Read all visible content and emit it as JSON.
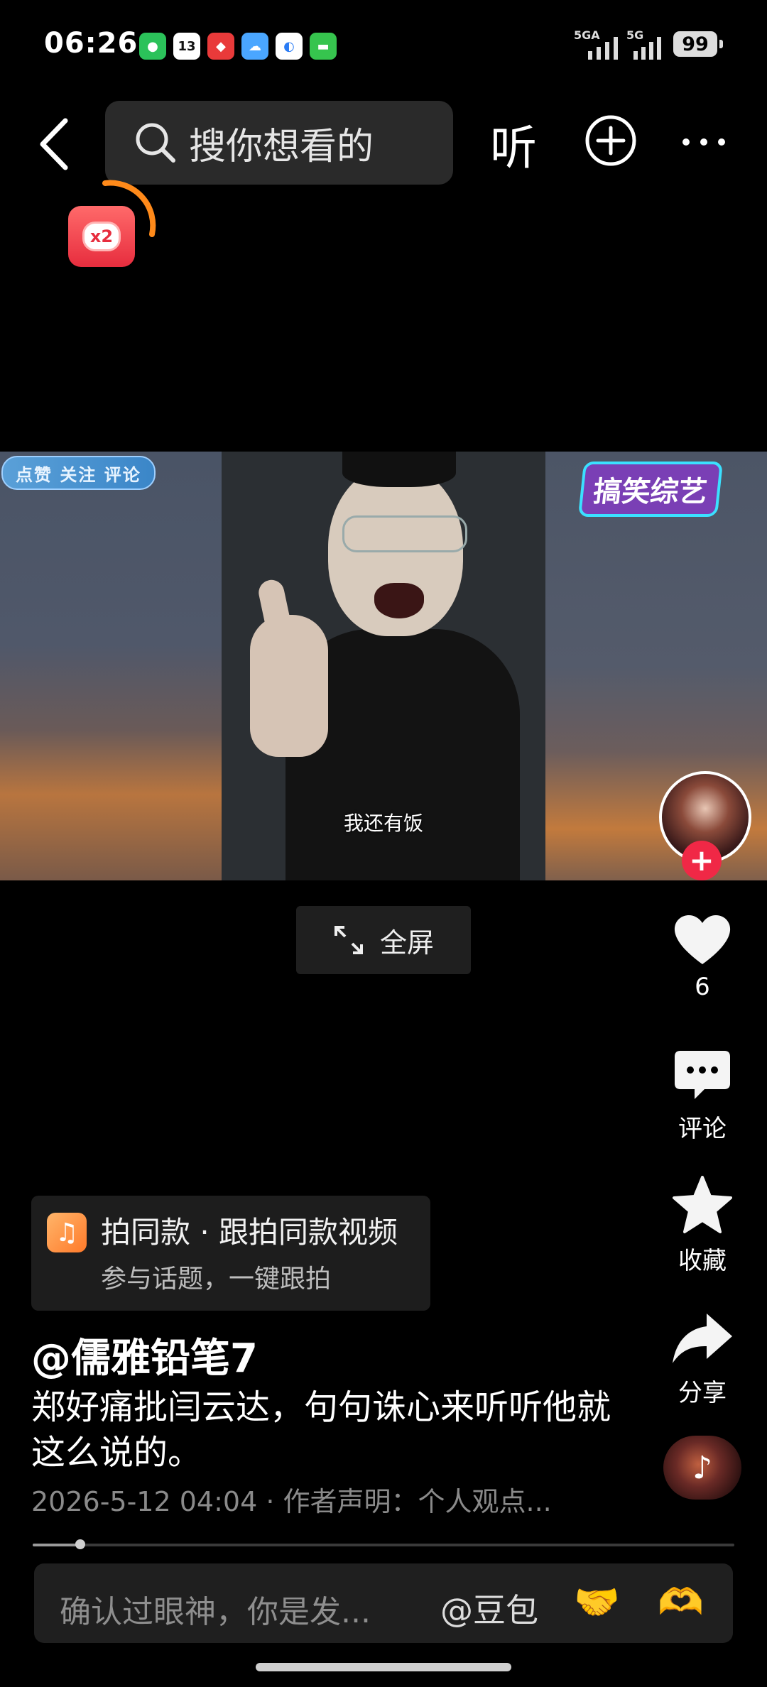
{
  "status_bar": {
    "time": "06:26",
    "notification_icons": [
      "wechat",
      "calendar",
      "game",
      "weather",
      "browser",
      "messages"
    ],
    "calendar_day": "13",
    "network_1": "5GA",
    "network_2": "5G",
    "battery": "99"
  },
  "top_bar": {
    "search_placeholder": "搜你想看的",
    "listen_label": "听"
  },
  "red_packet": {
    "multiplier": "x2"
  },
  "video": {
    "subtitle": "我还有饭",
    "left_tag": "点赞 关注 评论",
    "right_tag": "搞笑综艺"
  },
  "fullscreen_label": "全屏",
  "rail": {
    "like_count": "6",
    "comment_label": "评论",
    "favorite_label": "收藏",
    "share_label": "分享"
  },
  "same_style": {
    "title": "拍同款 · 跟拍同款视频",
    "subtitle": "参与话题，一键跟拍"
  },
  "post": {
    "author": "@儒雅铅笔7",
    "description": "郑好痛批闫云达，句句诛心来听听他就这么说的。",
    "meta": "2026-5-12 04:04 · 作者声明：个人观点..."
  },
  "progress": {
    "played_fraction": 0.068
  },
  "comment_bar": {
    "placeholder": "确认过眼神，你是发...",
    "mention": "@豆包",
    "emoji_1": "🤝",
    "emoji_2": "🫶"
  },
  "colors": {
    "background": "#000000",
    "accent_red": "#f02846",
    "card": "#1d1d1d"
  }
}
